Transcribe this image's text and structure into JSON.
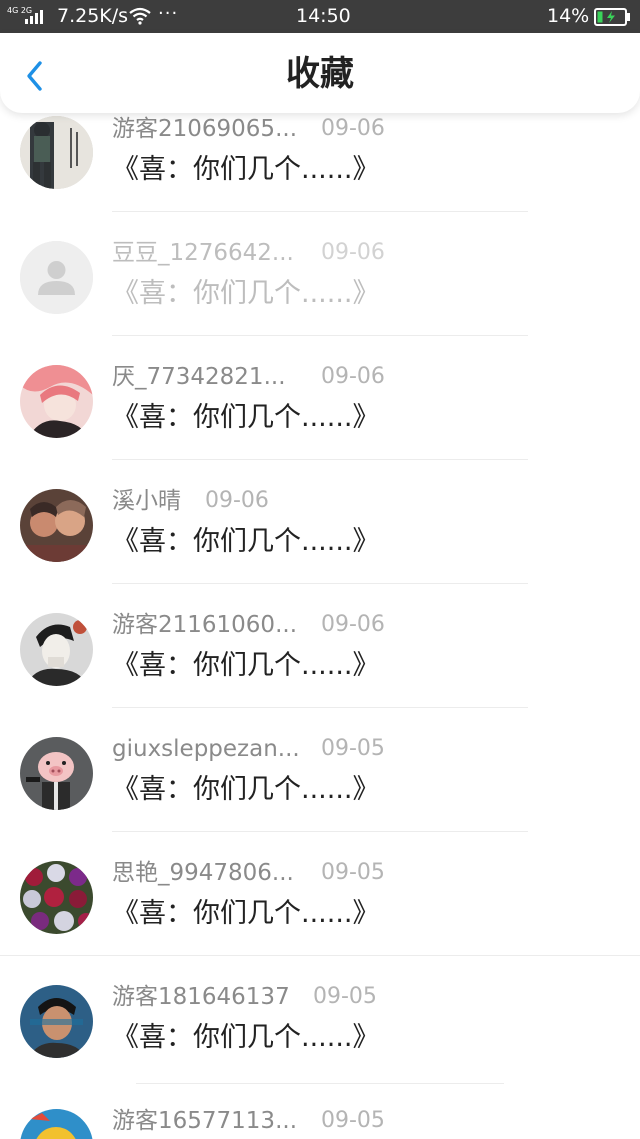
{
  "status_bar": {
    "network": "4G 2G",
    "speed": "7.25K/s",
    "more": "···",
    "time": "14:50",
    "battery": "14%",
    "icons": [
      "signal-icon",
      "wifi-icon",
      "battery-charging-icon"
    ]
  },
  "header": {
    "back_icon": "chevron-left-icon",
    "title": "收藏"
  },
  "favorites": [
    {
      "user": "游客21069065...",
      "date": "09-06",
      "title": "《喜：你们几个......》",
      "faded": false
    },
    {
      "user": "豆豆_1276642...",
      "date": "09-06",
      "title": "《喜：你们几个......》",
      "faded": true
    },
    {
      "user": "厌_77342821...",
      "date": "09-06",
      "title": "《喜：你们几个......》",
      "faded": false
    },
    {
      "user": "溪小晴",
      "date": "09-06",
      "title": "《喜：你们几个......》",
      "faded": false
    },
    {
      "user": "游客21161060...",
      "date": "09-06",
      "title": "《喜：你们几个......》",
      "faded": false
    },
    {
      "user": "giuxsleppezan...",
      "date": "09-05",
      "title": "《喜：你们几个......》",
      "faded": false
    },
    {
      "user": "思艳_9947806...",
      "date": "09-05",
      "title": "《喜：你们几个......》",
      "faded": false
    },
    {
      "user": "游客181646137",
      "date": "09-05",
      "title": "《喜：你们几个......》",
      "faded": false
    },
    {
      "user": "游客16577113...",
      "date": "09-05",
      "title": "",
      "faded": false
    }
  ],
  "colors": {
    "accent": "#1e90e6",
    "status_bar": "#3d3d3d",
    "username": "#8a8a8a",
    "date": "#b4b4b4",
    "title": "#222222"
  }
}
